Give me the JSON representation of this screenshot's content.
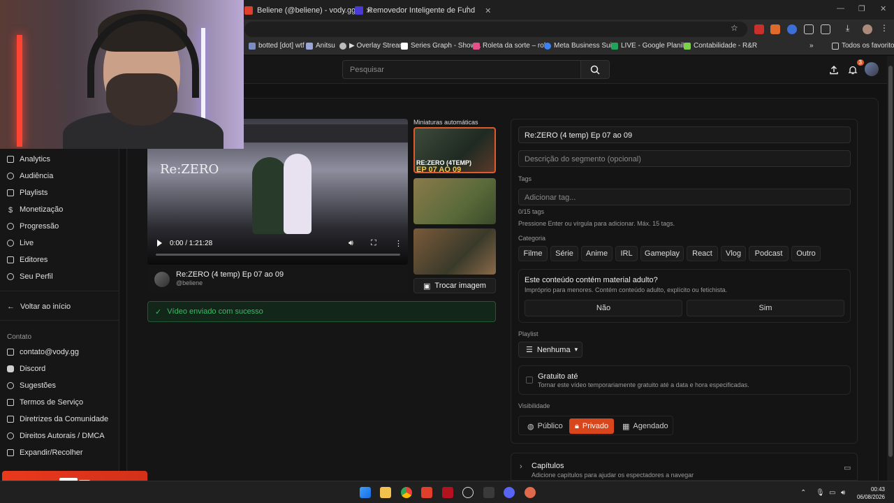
{
  "browser": {
    "tabs": [
      {
        "label": "Beliene (@beliene) - vody.gg",
        "color": "#e0402b"
      },
      {
        "label": "Removedor Inteligente de Fund",
        "color": "#4b3bd6"
      }
    ],
    "bookmarks": [
      {
        "label": "botted [dot] wtf",
        "color": "#7b8cc4"
      },
      {
        "label": "Anitsu",
        "color": "#9aa6d8"
      },
      {
        "label": "▶ Overlay Stream",
        "color": "#bbbbbb"
      },
      {
        "label": "Series Graph - Show...",
        "color": "#ffffff"
      },
      {
        "label": "Roleta da sorte – rol...",
        "color": "#e84f8a"
      },
      {
        "label": "Meta Business Suite",
        "color": "#3b82f6"
      },
      {
        "label": "LIVE - Google Planil...",
        "color": "#22a35a"
      },
      {
        "label": "Contabilidade - R&R",
        "color": "#7bd14a"
      }
    ],
    "all_bookmarks_label": "Todos os favoritos"
  },
  "header": {
    "search_placeholder": "Pesquisar",
    "notification_count": "3"
  },
  "sidebar": {
    "items": [
      {
        "label": "Analytics",
        "name": "sidebar-item-analytics"
      },
      {
        "label": "Audiência",
        "name": "sidebar-item-audiencia"
      },
      {
        "label": "Playlists",
        "name": "sidebar-item-playlists"
      },
      {
        "label": "Monetização",
        "name": "sidebar-item-monetizacao"
      },
      {
        "label": "Progressão",
        "name": "sidebar-item-progressao"
      },
      {
        "label": "Live",
        "name": "sidebar-item-live"
      },
      {
        "label": "Editores",
        "name": "sidebar-item-editores"
      },
      {
        "label": "Seu Perfil",
        "name": "sidebar-item-seu-perfil"
      }
    ],
    "back_label": "Voltar ao início",
    "contact_label": "Contato",
    "contact_items": [
      {
        "label": "contato@vody.gg",
        "name": "contact-email"
      },
      {
        "label": "Discord",
        "name": "contact-discord"
      },
      {
        "label": "Sugestões",
        "name": "contact-sugestoes"
      },
      {
        "label": "Termos de Serviço",
        "name": "contact-termos"
      },
      {
        "label": "Diretrizes da Comunidade",
        "name": "contact-diretrizes"
      },
      {
        "label": "Direitos Autorais / DMCA",
        "name": "contact-dmca"
      },
      {
        "label": "Expandir/Recolher",
        "name": "contact-expandir"
      }
    ]
  },
  "player": {
    "time": "0:00 / 1:21:28",
    "screen_title": "Re:ZERO",
    "video_title": "Re:ZERO (4 temp) Ep 07 ao 09",
    "username": "@beliene"
  },
  "thumbnails": {
    "label": "Miniaturas automáticas",
    "overlay_line1": "RE:ZERO (4TEMP)",
    "overlay_line2": "EP 07 AO 09",
    "swap_label": "Trocar imagem"
  },
  "toast": {
    "message": "Vídeo enviado com sucesso"
  },
  "form": {
    "title_value": "Re:ZERO (4 temp) Ep 07 ao 09",
    "description_placeholder": "Descrição do segmento (opcional)",
    "tags_label": "Tags",
    "tags_placeholder": "Adicionar tag...",
    "tags_count": "0/15 tags",
    "tags_hint": "Pressione Enter ou vírgula para adicionar. Máx. 15 tags.",
    "category_label": "Categoria",
    "categories": [
      "Filme",
      "Série",
      "Anime",
      "IRL",
      "Gameplay",
      "React",
      "Vlog",
      "Podcast",
      "Outro"
    ],
    "adult_title": "Este conteúdo contém material adulto?",
    "adult_sub": "Impróprio para menores. Contém conteúdo adulto, explícito ou fetichista.",
    "adult_no": "Não",
    "adult_yes": "Sim",
    "playlist_label": "Playlist",
    "playlist_value": "Nenhuma",
    "free_title": "Gratuito até",
    "free_sub": "Tornar este vídeo temporariamente gratuito até a data e hora especificadas.",
    "visibility_label": "Visibilidade",
    "visibility_options": [
      "Público",
      "Privado",
      "Agendado"
    ],
    "visibility_selected": "Privado",
    "chapters_title": "Capítulos",
    "chapters_sub": "Adicione capítulos para ajudar os espectadores a navegar"
  },
  "taskbar": {
    "time": "00:43",
    "date": "06/08/2026"
  },
  "colors": {
    "accent": "#d9461c",
    "success": "#3fb868",
    "background": "#121212"
  }
}
